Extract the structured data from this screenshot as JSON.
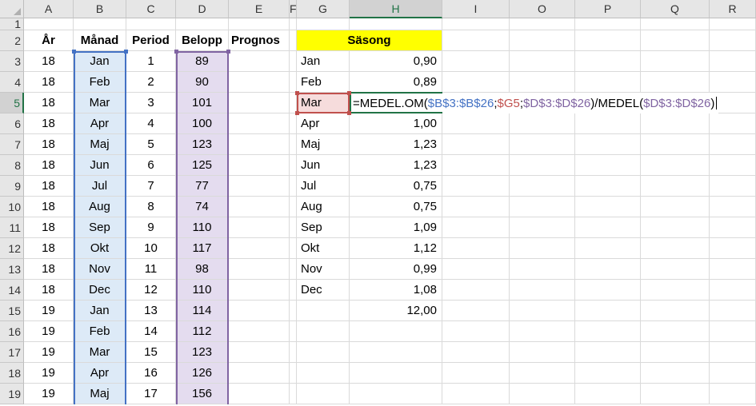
{
  "columns": [
    "A",
    "B",
    "C",
    "D",
    "E",
    "F",
    "G",
    "H",
    "I",
    "O",
    "P",
    "Q",
    "R"
  ],
  "active_column": "H",
  "active_row": "5",
  "rows": [
    {
      "num": "1",
      "cells": {}
    },
    {
      "num": "2",
      "cells": {
        "A": "År",
        "B": "Månad",
        "C": "Period",
        "D": "Belopp",
        "E": "Prognos",
        "H": "Säsong"
      }
    },
    {
      "num": "3",
      "cells": {
        "A": "18",
        "B": "Jan",
        "C": "1",
        "D": "89",
        "G": "Jan",
        "H": "0,90"
      }
    },
    {
      "num": "4",
      "cells": {
        "A": "18",
        "B": "Feb",
        "C": "2",
        "D": "90",
        "G": "Feb",
        "H": "0,89"
      }
    },
    {
      "num": "5",
      "cells": {
        "A": "18",
        "B": "Mar",
        "C": "3",
        "D": "101",
        "G": "Mar"
      }
    },
    {
      "num": "6",
      "cells": {
        "A": "18",
        "B": "Apr",
        "C": "4",
        "D": "100",
        "G": "Apr",
        "H": "1,00"
      }
    },
    {
      "num": "7",
      "cells": {
        "A": "18",
        "B": "Maj",
        "C": "5",
        "D": "123",
        "G": "Maj",
        "H": "1,23"
      }
    },
    {
      "num": "8",
      "cells": {
        "A": "18",
        "B": "Jun",
        "C": "6",
        "D": "125",
        "G": "Jun",
        "H": "1,23"
      }
    },
    {
      "num": "9",
      "cells": {
        "A": "18",
        "B": "Jul",
        "C": "7",
        "D": "77",
        "G": "Jul",
        "H": "0,75"
      }
    },
    {
      "num": "10",
      "cells": {
        "A": "18",
        "B": "Aug",
        "C": "8",
        "D": "74",
        "G": "Aug",
        "H": "0,75"
      }
    },
    {
      "num": "11",
      "cells": {
        "A": "18",
        "B": "Sep",
        "C": "9",
        "D": "110",
        "G": "Sep",
        "H": "1,09"
      }
    },
    {
      "num": "12",
      "cells": {
        "A": "18",
        "B": "Okt",
        "C": "10",
        "D": "117",
        "G": "Okt",
        "H": "1,12"
      }
    },
    {
      "num": "13",
      "cells": {
        "A": "18",
        "B": "Nov",
        "C": "11",
        "D": "98",
        "G": "Nov",
        "H": "0,99"
      }
    },
    {
      "num": "14",
      "cells": {
        "A": "18",
        "B": "Dec",
        "C": "12",
        "D": "110",
        "G": "Dec",
        "H": "1,08"
      }
    },
    {
      "num": "15",
      "cells": {
        "A": "19",
        "B": "Jan",
        "C": "13",
        "D": "114",
        "H": "12,00"
      }
    },
    {
      "num": "16",
      "cells": {
        "A": "19",
        "B": "Feb",
        "C": "14",
        "D": "112"
      }
    },
    {
      "num": "17",
      "cells": {
        "A": "19",
        "B": "Mar",
        "C": "15",
        "D": "123"
      }
    },
    {
      "num": "18",
      "cells": {
        "A": "19",
        "B": "Apr",
        "C": "16",
        "D": "126"
      }
    },
    {
      "num": "19",
      "cells": {
        "A": "19",
        "B": "Maj",
        "C": "17",
        "D": "156"
      }
    }
  ],
  "formula": {
    "p1": "=MEDEL.OM(",
    "p2": "$B$3:$B$26",
    "p3": ";",
    "p4": "$G5",
    "p5": ";",
    "p6": "$D$3:$D$26",
    "p7": ")/MEDEL(",
    "p8": "$D$3:$D$26",
    "p9": ")"
  },
  "colors": {
    "ref_blue": "#4472c4",
    "ref_red": "#c0504d",
    "ref_purple": "#8064a2",
    "header_fill": "#ffff00",
    "active_green": "#217346"
  }
}
